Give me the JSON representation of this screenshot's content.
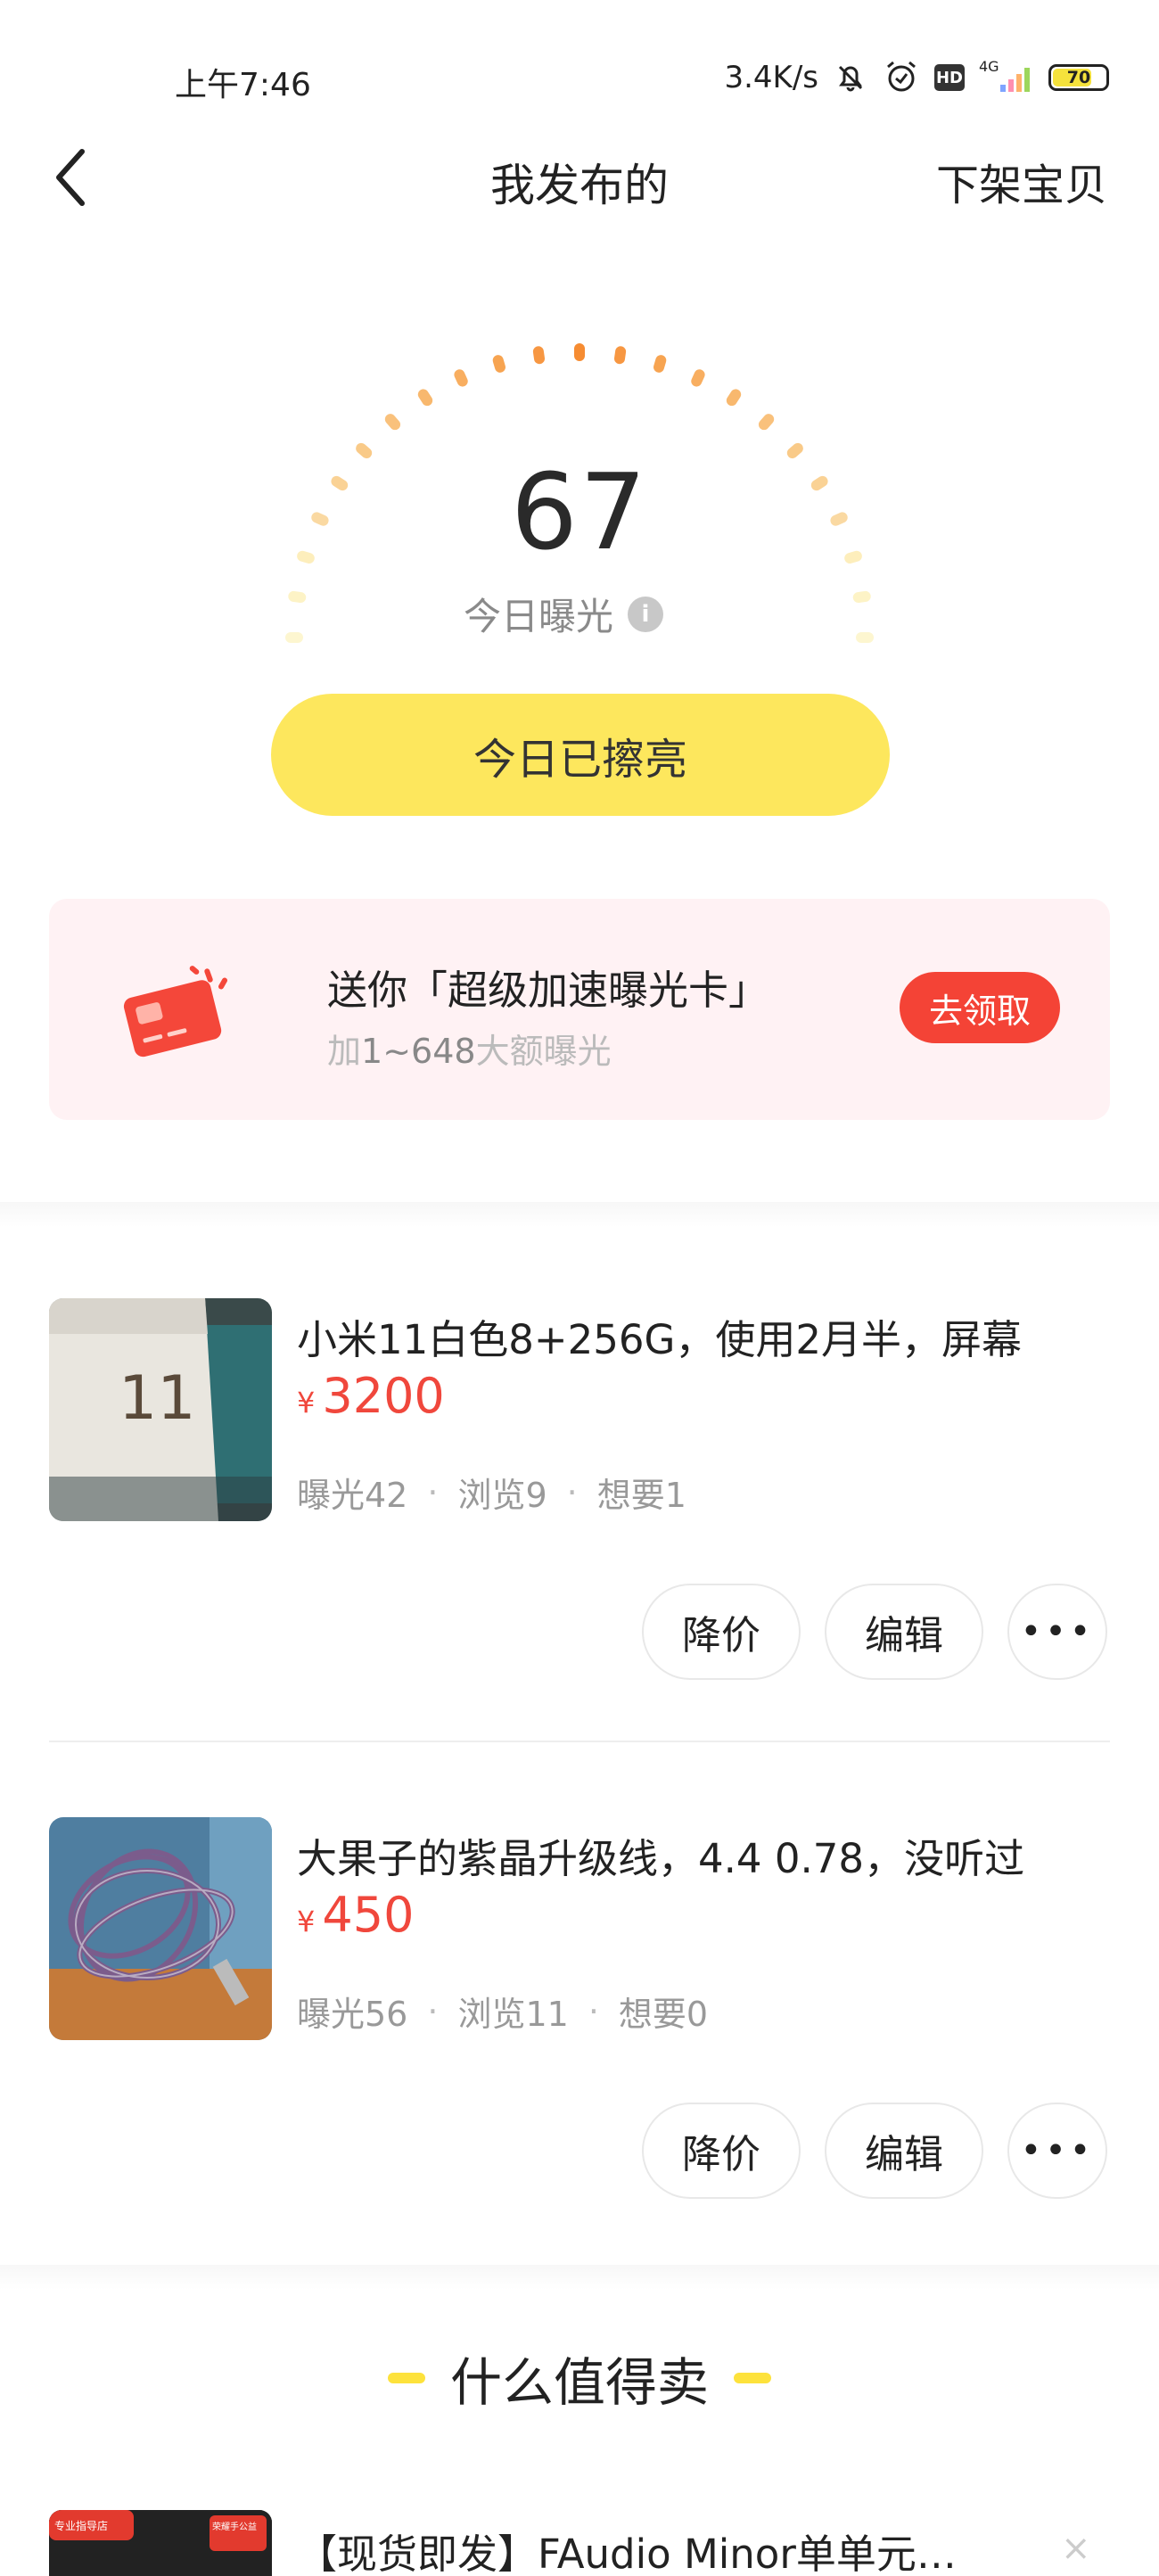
{
  "status_bar": {
    "time": "上午7:46",
    "speed": "3.4K/s",
    "hd": "HD",
    "network": "4G",
    "battery": "70",
    "icons": [
      "mute-bell-icon",
      "alarm-icon",
      "hd-icon",
      "signal-icon",
      "battery-icon"
    ]
  },
  "header": {
    "title": "我发布的",
    "action": "下架宝贝",
    "back_icon": "chevron-left-icon"
  },
  "exposure": {
    "value": "67",
    "label": "今日曝光",
    "info_icon": "i",
    "polish_button": "今日已擦亮"
  },
  "promo": {
    "title": "送你「超级加速曝光卡」",
    "sub_prefix": "加",
    "sub_range": "1~648",
    "sub_suffix": "大额曝光",
    "button": "去领取",
    "icon": "red-card-icon"
  },
  "listings": [
    {
      "title": "小米11白色8+256G，使用2月半，屏幕",
      "currency": "¥",
      "price": "3200",
      "stats": [
        "曝光42",
        "浏览9",
        "想要1"
      ],
      "buttons": {
        "reduce": "降价",
        "edit": "编辑",
        "more": "•••"
      },
      "thumb_text": "11"
    },
    {
      "title": "大果子的紫晶升级线，4.4 0.78，没听过",
      "currency": "¥",
      "price": "450",
      "stats": [
        "曝光56",
        "浏览11",
        "想要0"
      ],
      "buttons": {
        "reduce": "降价",
        "edit": "编辑",
        "more": "•••"
      }
    }
  ],
  "recommend": {
    "section_title": "什么值得卖",
    "items": [
      {
        "title": "【现货即发】FAudio Minor单单元…",
        "close": "×",
        "badge_left": "专业指导店",
        "badge_right": "荣耀手公益"
      }
    ]
  },
  "colors": {
    "accent_yellow": "#fde75d",
    "price_red": "#f0473c",
    "promo_bg": "#fff2f4",
    "promo_button": "#f44336"
  }
}
